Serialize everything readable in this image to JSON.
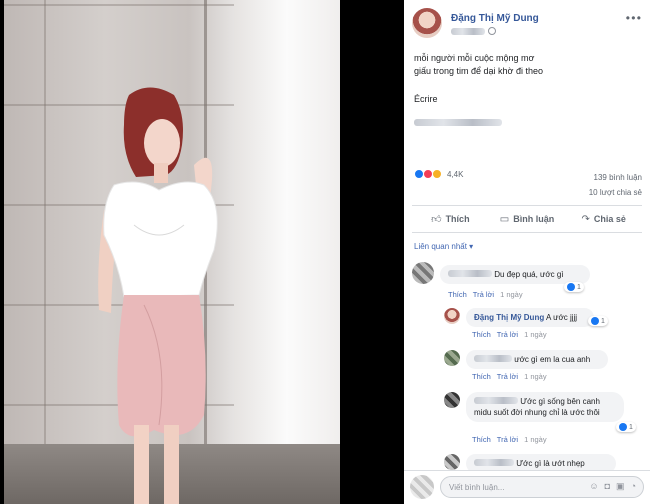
{
  "post": {
    "author": "Đặng Thị Mỹ Dung",
    "more_icon": "ellipsis-icon",
    "text_lines": [
      "mỗi người mỗi cuộc mộng mơ",
      "giấu trong tim để dại khờ đi theo"
    ],
    "ecrire": "Écrire",
    "reaction_count": "4,4K",
    "comment_count": "139 bình luận",
    "share_count": "10 lượt chia sẻ"
  },
  "actions": {
    "like": "Thích",
    "comment": "Bình luận",
    "share": "Chia sẻ"
  },
  "sort_label": "Liên quan nhất ▾",
  "comments": [
    {
      "text": "Du đẹp quá, ước gì",
      "like": "Thích",
      "reply": "Trả lời",
      "time": "1 ngày",
      "reactions": "1"
    },
    {
      "name": "Đặng Thị Mỹ Dung",
      "text": "A ước jjjj",
      "like": "Thích",
      "reply": "Trả lời",
      "time": "1 ngày",
      "reactions": "1"
    },
    {
      "text": "ước gì em la cua anh",
      "like": "Thích",
      "reply": "Trả lời",
      "time": "1 ngày"
    },
    {
      "text": "Ước gì sống bên canh midu suốt đời nhung chỉ là ước thôi",
      "like": "Thích",
      "reply": "Trả lời",
      "time": "1 ngày",
      "reactions": "1"
    },
    {
      "text": "Ước gì là ướt nhẹp"
    }
  ],
  "composer": {
    "placeholder": "Viết bình luận..."
  },
  "colors": {
    "link": "#365899",
    "accent": "#4267b2",
    "like_blue": "#1877f2"
  }
}
